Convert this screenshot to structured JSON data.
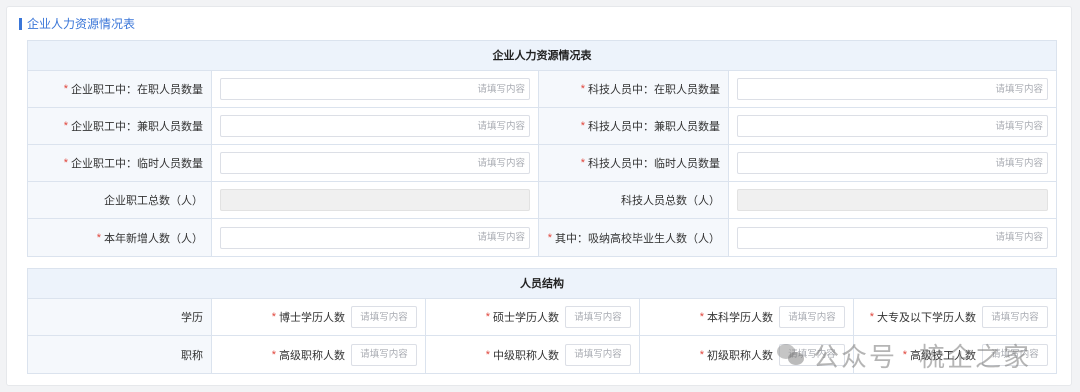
{
  "page": {
    "section_title": "企业人力资源情况表"
  },
  "hr_table": {
    "title": "企业人力资源情况表",
    "rows": [
      {
        "left_label": "企业职工中：在职人员数量",
        "left_required": true,
        "left_placeholder": "请填写内容",
        "left_disabled": false,
        "right_label": "科技人员中：在职人员数量",
        "right_required": true,
        "right_placeholder": "请填写内容",
        "right_disabled": false
      },
      {
        "left_label": "企业职工中：兼职人员数量",
        "left_required": true,
        "left_placeholder": "请填写内容",
        "left_disabled": false,
        "right_label": "科技人员中：兼职人员数量",
        "right_required": true,
        "right_placeholder": "请填写内容",
        "right_disabled": false
      },
      {
        "left_label": "企业职工中：临时人员数量",
        "left_required": true,
        "left_placeholder": "请填写内容",
        "left_disabled": false,
        "right_label": "科技人员中：临时人员数量",
        "right_required": true,
        "right_placeholder": "请填写内容",
        "right_disabled": false
      },
      {
        "left_label": "企业职工总数（人）",
        "left_required": false,
        "left_placeholder": "",
        "left_disabled": true,
        "right_label": "科技人员总数（人）",
        "right_required": false,
        "right_placeholder": "",
        "right_disabled": true
      },
      {
        "left_label": "本年新增人数（人）",
        "left_required": true,
        "left_placeholder": "请填写内容",
        "left_disabled": false,
        "right_label": "其中：吸纳高校毕业生人数（人）",
        "right_required": true,
        "right_placeholder": "请填写内容",
        "right_disabled": false
      }
    ]
  },
  "structure_table": {
    "title": "人员结构",
    "rows": [
      {
        "label": "学历",
        "fields": [
          {
            "label": "博士学历人数",
            "placeholder": "请填写内容"
          },
          {
            "label": "硕士学历人数",
            "placeholder": "请填写内容"
          },
          {
            "label": "本科学历人数",
            "placeholder": "请填写内容"
          },
          {
            "label": "大专及以下学历人数",
            "placeholder": "请填写内容"
          }
        ]
      },
      {
        "label": "职称",
        "fields": [
          {
            "label": "高级职称人数",
            "placeholder": "请填写内容"
          },
          {
            "label": "中级职称人数",
            "placeholder": "请填写内容"
          },
          {
            "label": "初级职称人数",
            "placeholder": "请填写内容"
          },
          {
            "label": "高级技工人数",
            "placeholder": "请填写内容"
          }
        ]
      }
    ]
  },
  "watermark": {
    "left_text": "公众号",
    "right_text": "梳企之家"
  },
  "colors": {
    "accent": "#3a76d8",
    "required": "#e0443a",
    "header_bg": "#edf3fb",
    "label_bg": "#f5f8fc"
  }
}
